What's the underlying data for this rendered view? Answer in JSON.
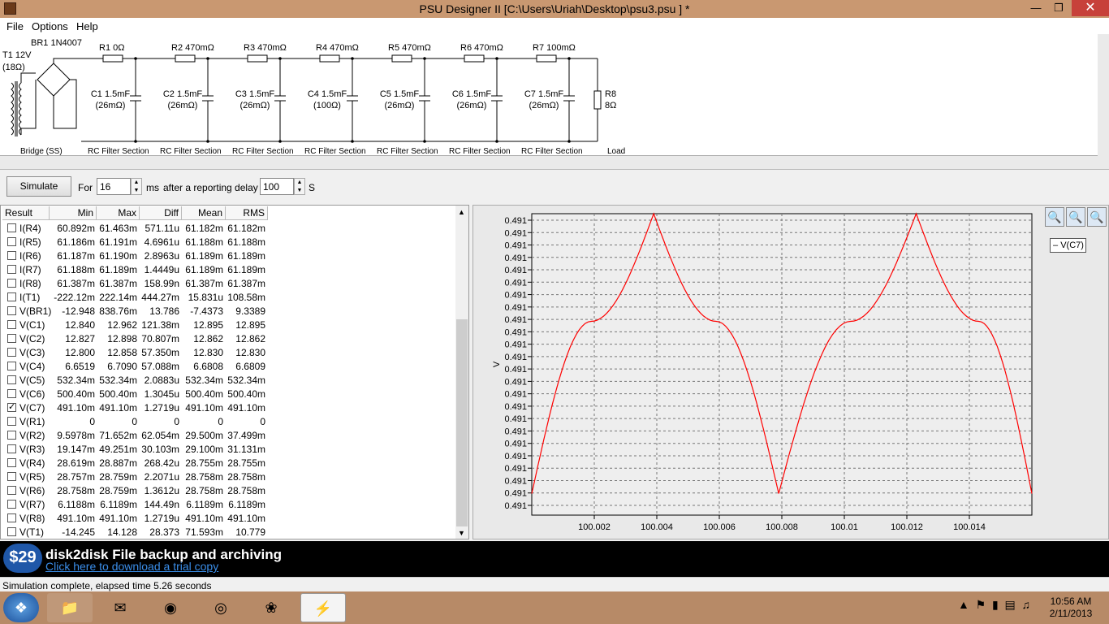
{
  "window": {
    "title": "PSU Designer II  [C:\\Users\\Uriah\\Desktop\\psu3.psu ] *"
  },
  "menu": [
    "File",
    "Options",
    "Help"
  ],
  "schematic": {
    "transformer": {
      "name": "T1 12V",
      "value": "(18Ω)"
    },
    "bridge": {
      "name": "BR1 1N4007",
      "label": "Bridge (SS)"
    },
    "resistors": [
      "R1 0Ω",
      "R2 470mΩ",
      "R3 470mΩ",
      "R4 470mΩ",
      "R5 470mΩ",
      "R6 470mΩ",
      "R7 100mΩ"
    ],
    "capacitors": [
      {
        "name": "C1 1.5mF",
        "esr": "(26mΩ)"
      },
      {
        "name": "C2 1.5mF",
        "esr": "(26mΩ)"
      },
      {
        "name": "C3 1.5mF",
        "esr": "(26mΩ)"
      },
      {
        "name": "C4 1.5mF",
        "esr": "(100Ω)"
      },
      {
        "name": "C5 1.5mF",
        "esr": "(26mΩ)"
      },
      {
        "name": "C6 1.5mF",
        "esr": "(26mΩ)"
      },
      {
        "name": "C7 1.5mF",
        "esr": "(26mΩ)"
      }
    ],
    "section_label": "RC Filter Section",
    "load": {
      "name": "R8",
      "value": "8Ω",
      "label": "Load"
    }
  },
  "toolbar": {
    "simulate": "Simulate",
    "for_label": "For",
    "for_value": "16",
    "ms_label": "ms",
    "delay_label": "after a reporting delay of",
    "delay_value": "100",
    "s_label": "S"
  },
  "results": {
    "headers": [
      "Result",
      "Min",
      "Max",
      "Diff",
      "Mean",
      "RMS"
    ],
    "rows": [
      {
        "checked": false,
        "name": "I(R4)",
        "min": "60.892m",
        "max": "61.463m",
        "diff": "571.11u",
        "mean": "61.182m",
        "rms": "61.182m"
      },
      {
        "checked": false,
        "name": "I(R5)",
        "min": "61.186m",
        "max": "61.191m",
        "diff": "4.6961u",
        "mean": "61.188m",
        "rms": "61.188m"
      },
      {
        "checked": false,
        "name": "I(R6)",
        "min": "61.187m",
        "max": "61.190m",
        "diff": "2.8963u",
        "mean": "61.189m",
        "rms": "61.189m"
      },
      {
        "checked": false,
        "name": "I(R7)",
        "min": "61.188m",
        "max": "61.189m",
        "diff": "1.4449u",
        "mean": "61.189m",
        "rms": "61.189m"
      },
      {
        "checked": false,
        "name": "I(R8)",
        "min": "61.387m",
        "max": "61.387m",
        "diff": "158.99n",
        "mean": "61.387m",
        "rms": "61.387m"
      },
      {
        "checked": false,
        "name": "I(T1)",
        "min": "-222.12m",
        "max": "222.14m",
        "diff": "444.27m",
        "mean": "15.831u",
        "rms": "108.58m"
      },
      {
        "checked": false,
        "name": "V(BR1)",
        "min": "-12.948",
        "max": "838.76m",
        "diff": "13.786",
        "mean": "-7.4373",
        "rms": "9.3389"
      },
      {
        "checked": false,
        "name": "V(C1)",
        "min": "12.840",
        "max": "12.962",
        "diff": "121.38m",
        "mean": "12.895",
        "rms": "12.895"
      },
      {
        "checked": false,
        "name": "V(C2)",
        "min": "12.827",
        "max": "12.898",
        "diff": "70.807m",
        "mean": "12.862",
        "rms": "12.862"
      },
      {
        "checked": false,
        "name": "V(C3)",
        "min": "12.800",
        "max": "12.858",
        "diff": "57.350m",
        "mean": "12.830",
        "rms": "12.830"
      },
      {
        "checked": false,
        "name": "V(C4)",
        "min": "6.6519",
        "max": "6.7090",
        "diff": "57.088m",
        "mean": "6.6808",
        "rms": "6.6809"
      },
      {
        "checked": false,
        "name": "V(C5)",
        "min": "532.34m",
        "max": "532.34m",
        "diff": "2.0883u",
        "mean": "532.34m",
        "rms": "532.34m"
      },
      {
        "checked": false,
        "name": "V(C6)",
        "min": "500.40m",
        "max": "500.40m",
        "diff": "1.3045u",
        "mean": "500.40m",
        "rms": "500.40m"
      },
      {
        "checked": true,
        "name": "V(C7)",
        "min": "491.10m",
        "max": "491.10m",
        "diff": "1.2719u",
        "mean": "491.10m",
        "rms": "491.10m"
      },
      {
        "checked": false,
        "name": "V(R1)",
        "min": "0",
        "max": "0",
        "diff": "0",
        "mean": "0",
        "rms": "0"
      },
      {
        "checked": false,
        "name": "V(R2)",
        "min": "9.5978m",
        "max": "71.652m",
        "diff": "62.054m",
        "mean": "29.500m",
        "rms": "37.499m"
      },
      {
        "checked": false,
        "name": "V(R3)",
        "min": "19.147m",
        "max": "49.251m",
        "diff": "30.103m",
        "mean": "29.100m",
        "rms": "31.131m"
      },
      {
        "checked": false,
        "name": "V(R4)",
        "min": "28.619m",
        "max": "28.887m",
        "diff": "268.42u",
        "mean": "28.755m",
        "rms": "28.755m"
      },
      {
        "checked": false,
        "name": "V(R5)",
        "min": "28.757m",
        "max": "28.759m",
        "diff": "2.2071u",
        "mean": "28.758m",
        "rms": "28.758m"
      },
      {
        "checked": false,
        "name": "V(R6)",
        "min": "28.758m",
        "max": "28.759m",
        "diff": "1.3612u",
        "mean": "28.758m",
        "rms": "28.758m"
      },
      {
        "checked": false,
        "name": "V(R7)",
        "min": "6.1188m",
        "max": "6.1189m",
        "diff": "144.49n",
        "mean": "6.1189m",
        "rms": "6.1189m"
      },
      {
        "checked": false,
        "name": "V(R8)",
        "min": "491.10m",
        "max": "491.10m",
        "diff": "1.2719u",
        "mean": "491.10m",
        "rms": "491.10m"
      },
      {
        "checked": false,
        "name": "V(T1)",
        "min": "-14.245",
        "max": "14.128",
        "diff": "28.373",
        "mean": "71.593m",
        "rms": "10.779"
      }
    ]
  },
  "chart_data": {
    "type": "line",
    "ylabel": "V",
    "xlim": [
      100.0,
      100.016
    ],
    "x_ticks": [
      "100.002",
      "100.004",
      "100.006",
      "100.008",
      "100.01",
      "100.012",
      "100.014"
    ],
    "y_ticks": [
      "0.491",
      "0.491",
      "0.491",
      "0.491",
      "0.491",
      "0.491",
      "0.491",
      "0.491",
      "0.491",
      "0.491",
      "0.491",
      "0.491",
      "0.491",
      "0.491",
      "0.491",
      "0.491",
      "0.491",
      "0.491",
      "0.491",
      "0.491",
      "0.491",
      "0.491",
      "0.491",
      "0.491"
    ],
    "grid": true,
    "legend": "top-right",
    "series": [
      {
        "name": "V(C7)",
        "color": "#ff0000",
        "x": [
          100.0,
          100.0019,
          100.0039,
          100.0059,
          100.0079,
          100.0102,
          100.0123,
          100.0143,
          100.016
        ],
        "y": [
          0.4910994,
          0.4911002,
          0.4911007,
          0.4911002,
          0.4910994,
          0.4911002,
          0.4911007,
          0.4911002,
          0.4910994
        ],
        "ylim": [
          0.4910993,
          0.4911007
        ]
      }
    ]
  },
  "ad": {
    "price": "$29",
    "title": "disk2disk File backup and archiving",
    "link": "Click here to download a trial copy"
  },
  "status": {
    "text": "Simulation complete, elapsed time 5.26 seconds"
  },
  "taskbar": {
    "time": "10:56 AM",
    "date": "2/11/2013"
  }
}
